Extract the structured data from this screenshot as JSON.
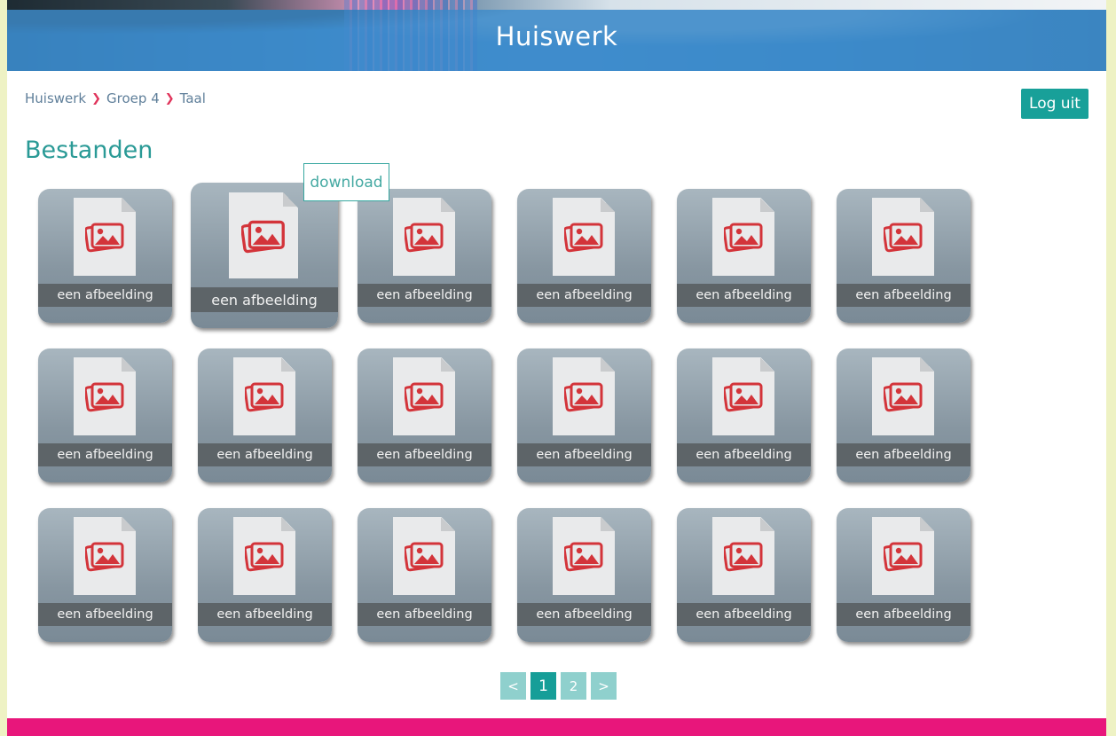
{
  "header": {
    "title": "Huiswerk"
  },
  "breadcrumb": [
    "Huiswerk",
    "Groep 4",
    "Taal"
  ],
  "logout_label": "Log uit",
  "section_title": "Bestanden",
  "tooltip": "download",
  "files": [
    {
      "label": "een afbeelding",
      "icon": "image-file-icon"
    },
    {
      "label": "een afbeelding",
      "icon": "image-file-icon"
    },
    {
      "label": "een afbeelding",
      "icon": "image-file-icon"
    },
    {
      "label": "een afbeelding",
      "icon": "image-file-icon"
    },
    {
      "label": "een afbeelding",
      "icon": "image-file-icon"
    },
    {
      "label": "een afbeelding",
      "icon": "image-file-icon"
    },
    {
      "label": "een afbeelding",
      "icon": "image-file-icon"
    },
    {
      "label": "een afbeelding",
      "icon": "image-file-icon"
    },
    {
      "label": "een afbeelding",
      "icon": "image-file-icon"
    },
    {
      "label": "een afbeelding",
      "icon": "image-file-icon"
    },
    {
      "label": "een afbeelding",
      "icon": "image-file-icon"
    },
    {
      "label": "een afbeelding",
      "icon": "image-file-icon"
    },
    {
      "label": "een afbeelding",
      "icon": "image-file-icon"
    },
    {
      "label": "een afbeelding",
      "icon": "image-file-icon"
    },
    {
      "label": "een afbeelding",
      "icon": "image-file-icon"
    },
    {
      "label": "een afbeelding",
      "icon": "image-file-icon"
    },
    {
      "label": "een afbeelding",
      "icon": "image-file-icon"
    },
    {
      "label": "een afbeelding",
      "icon": "image-file-icon"
    }
  ],
  "pagination": {
    "prev": "<",
    "pages": [
      "1",
      "2"
    ],
    "current": "1",
    "next": ">"
  },
  "colors": {
    "accent": "#18a099",
    "footer": "#e8167b",
    "header_band": "#3c8ccd",
    "icon_red": "#d3343a"
  }
}
